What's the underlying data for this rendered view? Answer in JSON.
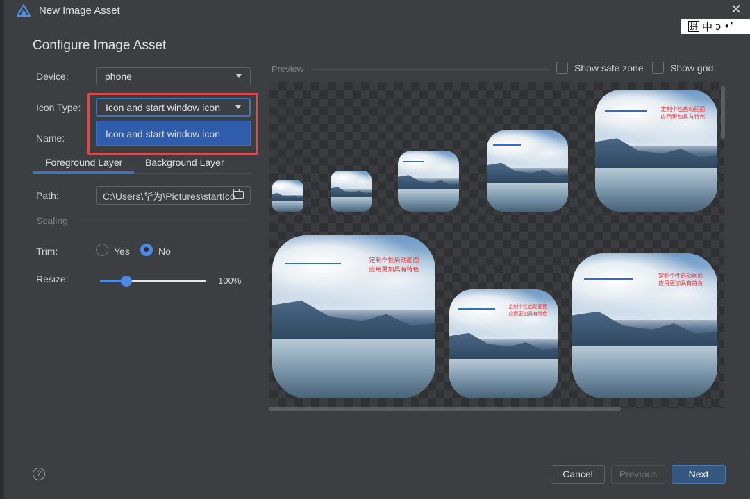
{
  "window": {
    "title": "New Image Asset",
    "close_glyph": "✕"
  },
  "ime": {
    "items": [
      "拼",
      "中",
      "ᴐ",
      "•ʼ"
    ]
  },
  "header": {
    "title": "Configure Image Asset"
  },
  "form": {
    "device_label": "Device:",
    "device_value": "phone",
    "icon_type_label": "Icon Type:",
    "icon_type_value": "Icon and start window icon",
    "icon_type_options": [
      "Icon and start window icon"
    ],
    "name_label": "Name:",
    "tabs": [
      "Foreground Layer",
      "Background Layer"
    ],
    "active_tab": "Foreground Layer",
    "path_label": "Path:",
    "path_value": "C:\\Users\\华为\\Pictures\\startIco",
    "scaling_label": "Scaling",
    "trim_label": "Trim:",
    "trim_options": [
      "Yes",
      "No"
    ],
    "trim_selected": "No",
    "resize_label": "Resize:",
    "resize_value": "100%",
    "resize_fraction": 0.25
  },
  "preview": {
    "label": "Preview",
    "show_safe_zone": "Show safe zone",
    "show_grid": "Show grid",
    "overlay_text_line1": "定制个性启动画面",
    "overlay_text_line2": "应用更加具有特色"
  },
  "footer": {
    "help_glyph": "?",
    "cancel": "Cancel",
    "previous": "Previous",
    "next": "Next"
  },
  "colors": {
    "accent": "#3a75c4",
    "highlight": "#e0474c",
    "dropdown_bg": "#2f5dab"
  }
}
